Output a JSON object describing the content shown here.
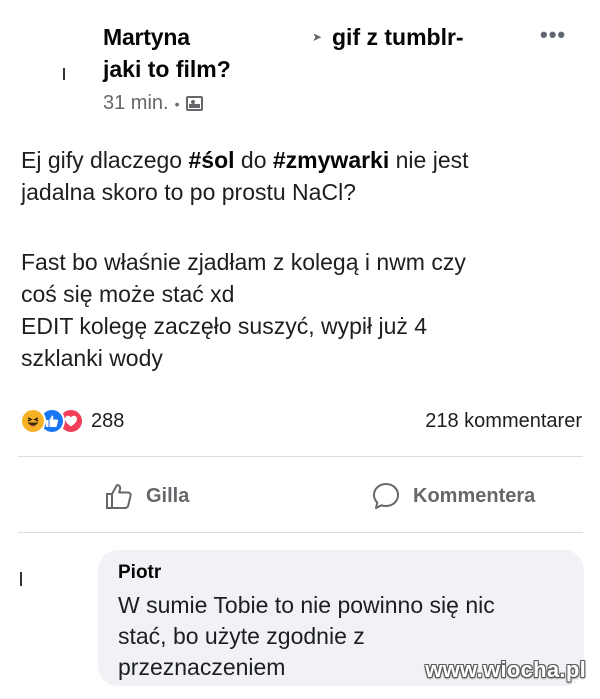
{
  "post": {
    "author": "Martyna",
    "group_name": "gif z tumblr-",
    "group_subtitle": "jaki to film?",
    "time": "31 min.",
    "separator": "•",
    "more_label": "•••",
    "text": {
      "line1_prefix": "Ej gify dlaczego ",
      "hashtag1": "#sol",
      "line1_mid": " do ",
      "hashtag2": "#zmywarki",
      "line1_suffix": " nie jest",
      "line2": "jadalna skoro to po prostu NaCl?",
      "line3": "Fast bo właśnie zjadłam z kolegą i nwm czy",
      "line4": "coś się może stać xd",
      "line5": "EDIT kolegę zaczęło suszyć, wypił już 4",
      "line6": "szklanki wody"
    },
    "hashtag1_display": "#śol",
    "reaction_count": "288",
    "comment_count": "218 kommentarer"
  },
  "actions": {
    "like_label": "Gilla",
    "comment_label": "Kommentera"
  },
  "comment": {
    "author": "Piotr",
    "line1": "W sumie Tobie to nie powinno się nic",
    "line2": "stać, bo użyte zgodnie z",
    "line3": "przeznaczeniem"
  },
  "watermark": "www.wiocha.pl",
  "icons": {
    "audience": "audience-icon",
    "haha": "haha-reaction-icon",
    "like": "like-reaction-icon",
    "love": "love-reaction-icon",
    "like_action": "thumbs-up-icon",
    "comment_action": "comment-bubble-icon"
  },
  "colors": {
    "like_blue": "#1877f2",
    "love_red": "#f33e58",
    "haha_yellow": "#f7b125",
    "bubble_bg": "#f0f2f5",
    "secondary_text": "#65676b"
  }
}
